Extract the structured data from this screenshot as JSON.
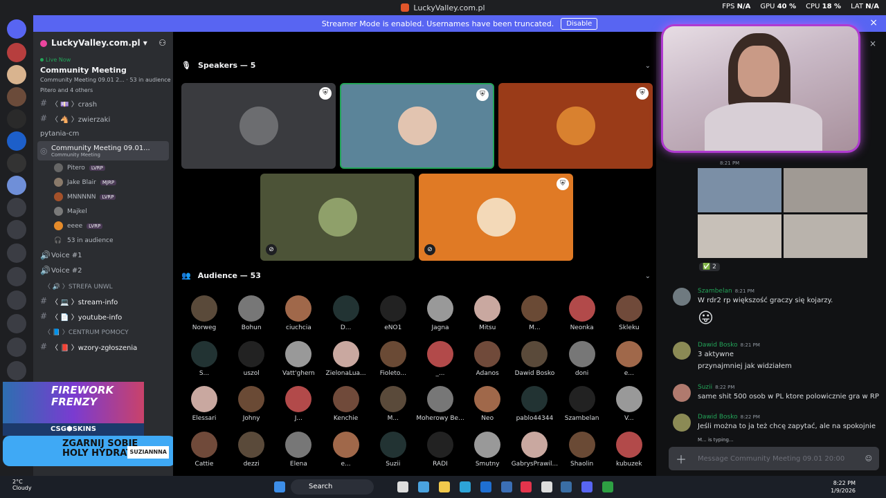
{
  "window": {
    "title": "LuckyValley.com.pl",
    "perf": {
      "fps_label": "FPS",
      "fps": "N/A",
      "gpu_label": "GPU",
      "gpu": "40 %",
      "cpu_label": "CPU",
      "cpu": "18 %",
      "lat_label": "LAT",
      "lat": "N/A"
    }
  },
  "banner": {
    "text": "Streamer Mode is enabled. Usernames have been truncated.",
    "disable": "Disable"
  },
  "server": {
    "name": "LuckyValley.com.pl",
    "live": "Live Now",
    "event_title": "Community Meeting",
    "event_sub": "Community Meeting 09.01 2...",
    "audience_count": "53 in audience",
    "others": "Pitero and 4 others"
  },
  "channels": [
    {
      "icon": "#",
      "name": "〈 💷 〉crash"
    },
    {
      "icon": "#",
      "name": "〈 🐴 〉zwierzaki"
    },
    {
      "icon": "",
      "name": "pytania-cm"
    }
  ],
  "active_channel": {
    "name": "Community Meeting 09.01...",
    "sub": "Community Meeting"
  },
  "members": [
    {
      "name": "Pitero",
      "tag": "LVRP"
    },
    {
      "name": "Jake Blair",
      "tag": "MJRP"
    },
    {
      "name": "MNNNNN",
      "tag": "LVRP"
    },
    {
      "name": "Majkel",
      "tag": ""
    },
    {
      "name": "eeee",
      "tag": "LVRP"
    }
  ],
  "in_audience": "53 in audience",
  "voice": [
    "Voice #1",
    "Voice #2"
  ],
  "cat1": "〈 🔊 〉STREFA UNWL",
  "channels2": [
    {
      "name": "〈 💻 〉stream-info"
    },
    {
      "name": "〈 📄 〉youtube-info"
    }
  ],
  "cat2": "〈 📘 〉CENTRUM POMOCY",
  "channels3": [
    {
      "name": "〈 📕 〉wzory-zgłoszenia"
    }
  ],
  "promo": {
    "title1": "FIREWORK",
    "title2": "FRENZY",
    "csg": "CSG⬢SKINS",
    "line1": "ZGARNIJ SOBIE",
    "line2": "HOLY HYDRATION",
    "tag": "SUZIANNNA"
  },
  "stage": {
    "speakers_label": "Speakers — 5",
    "audience_label": "Audience — 53"
  },
  "audience": [
    [
      "Norweg",
      "Bohun",
      "ciuchcia",
      "D...",
      "eNO1",
      "Jagna",
      "Mitsu",
      "M...",
      "Neonka",
      "Skleku"
    ],
    [
      "S...",
      "uszol",
      "Vatt'ghern",
      "ZielonaLua...",
      "Fioleto...",
      "_...",
      "Adanos",
      "Dawid Bosko",
      "doni",
      "e..."
    ],
    [
      "Elessari",
      "Johny",
      "J...",
      "Kenchie",
      "M...",
      "Moherowy Be...",
      "Neo",
      "pablo44344",
      "Szambelan",
      "V..."
    ],
    [
      "Cattie",
      "dezzi",
      "Elena",
      "e...",
      "Suzii",
      "RADI",
      "Smutny",
      "GabrysPrawil...",
      "Shaolin",
      "kubuzek"
    ]
  ],
  "chat": {
    "top_time": "8:21 PM",
    "reaction_count": "2",
    "messages": [
      {
        "author": "Szambelan",
        "time": "8:21 PM",
        "text": "W rdr2 rp większość graczy się kojarzy.",
        "extra": ""
      },
      {
        "author": "Dawid Bosko",
        "time": "8:21 PM",
        "text": "3 aktywne",
        "extra": "przynajmniej jak widziałem"
      },
      {
        "author": "Suzii",
        "time": "8:22 PM",
        "text": "same shit 500 osob w PL ktore polowicznie gra w RP",
        "extra": ""
      },
      {
        "author": "Dawid Bosko",
        "time": "8:22 PM",
        "text": "Jeśli można to ja też chcę zapytać, ale na spokojnie",
        "extra": ""
      }
    ],
    "typing": "M... is typing...",
    "placeholder": "Message Community Meeting 09.01 20:00"
  },
  "taskbar": {
    "temp": "2°C",
    "weather": "Cloudy",
    "search": "Search",
    "time": "8:22 PM",
    "date": "1/9/2026"
  }
}
